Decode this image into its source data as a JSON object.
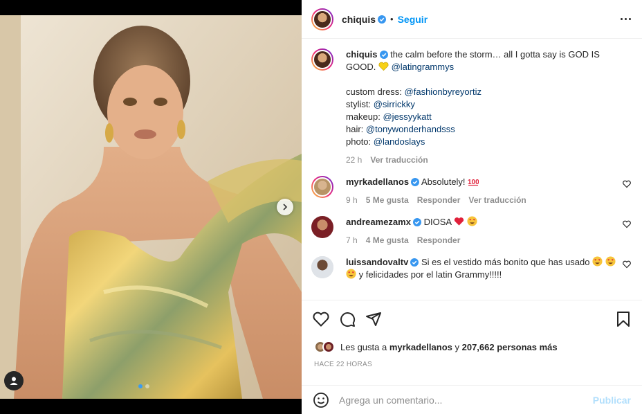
{
  "post": {
    "author": "chiquis",
    "follow_label": "Seguir",
    "dot": "•",
    "caption_line1": "the calm before the storm… all I gotta say is GOD IS GOOD.",
    "caption_mention": "@latingrammys",
    "credits": [
      {
        "label": "custom dress: ",
        "handle": "@fashionbyreyortiz"
      },
      {
        "label": "stylist: ",
        "handle": "@sirrickky"
      },
      {
        "label": "makeup: ",
        "handle": "@jessyykatt"
      },
      {
        "label": "hair: ",
        "handle": "@tonywonderhandsss"
      },
      {
        "label": "photo: ",
        "handle": "@landoslays"
      }
    ],
    "caption_time": "22 h",
    "caption_translate": "Ver traducción"
  },
  "comments": [
    {
      "user": "myrkadellanos",
      "text": "Absolutely!",
      "time": "9 h",
      "likes": "5 Me gusta",
      "reply": "Responder",
      "translate": "Ver traducción"
    },
    {
      "user": "andreamezamx",
      "text": "DIOSA",
      "time": "7 h",
      "likes": "4 Me gusta",
      "reply": "Responder"
    },
    {
      "user": "luissandovaltv",
      "text_a": "Si es el vestido más bonito que has usado",
      "text_b": "y felicidades por el latin Grammy!!!!!"
    }
  ],
  "likes": {
    "prefix": "Les gusta a ",
    "user": "myrkadellanos",
    "middle": " y ",
    "count": "207,662 personas más"
  },
  "timestamp": "HACE 22 HORAS",
  "composer": {
    "placeholder": "Agrega un comentario...",
    "post_label": "Publicar"
  },
  "icons": [
    "verified-badge-icon",
    "more-options-icon",
    "heart-icon",
    "comment-icon",
    "share-icon",
    "bookmark-icon",
    "emoji-icon",
    "chevron-right-icon",
    "user-tag-icon"
  ],
  "colors": {
    "accent": "#0095f6",
    "link": "#00376b",
    "muted": "#8e8e8e",
    "post_disabled": "#b2dffc"
  }
}
